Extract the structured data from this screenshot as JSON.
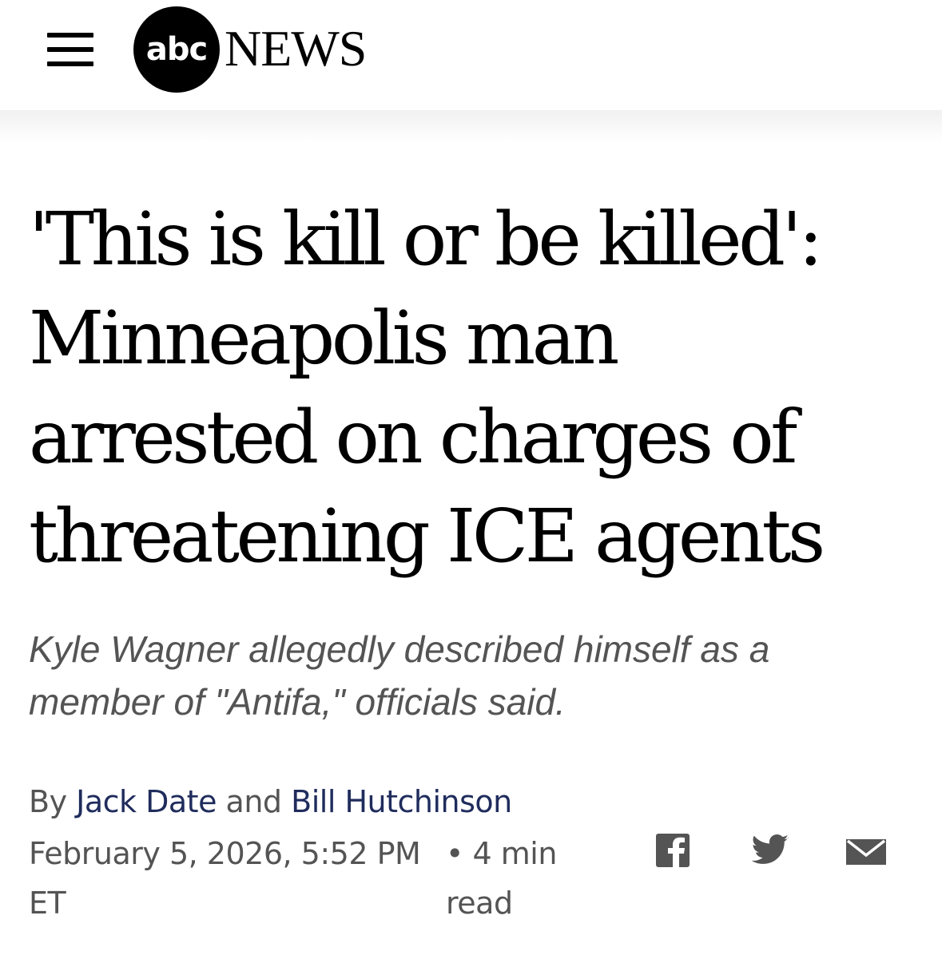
{
  "header": {
    "logo_abc": "abc",
    "logo_news": "NEWS"
  },
  "article": {
    "headline_lines": [
      "'This is kill or be killed':",
      "Minneapolis man",
      "arrested on charges of",
      "threatening ICE agents"
    ],
    "dek_lines": [
      "Kyle Wagner allegedly described himself as a",
      "member of \"Antifa,\" officials said."
    ],
    "byline": {
      "by": "By",
      "author1": "Jack Date",
      "and": "and",
      "author2": "Bill Hutchinson"
    },
    "date_line1": "February 5, 2026, 5:52 PM",
    "date_line2": "ET",
    "read_line1": "• 4 min",
    "read_line2": "read"
  },
  "share": {
    "icons": [
      "facebook-icon",
      "twitter-icon",
      "email-icon"
    ],
    "color": "#545454"
  },
  "colors": {
    "author_link": "#1f2c5c",
    "meta_gray": "#545454"
  }
}
